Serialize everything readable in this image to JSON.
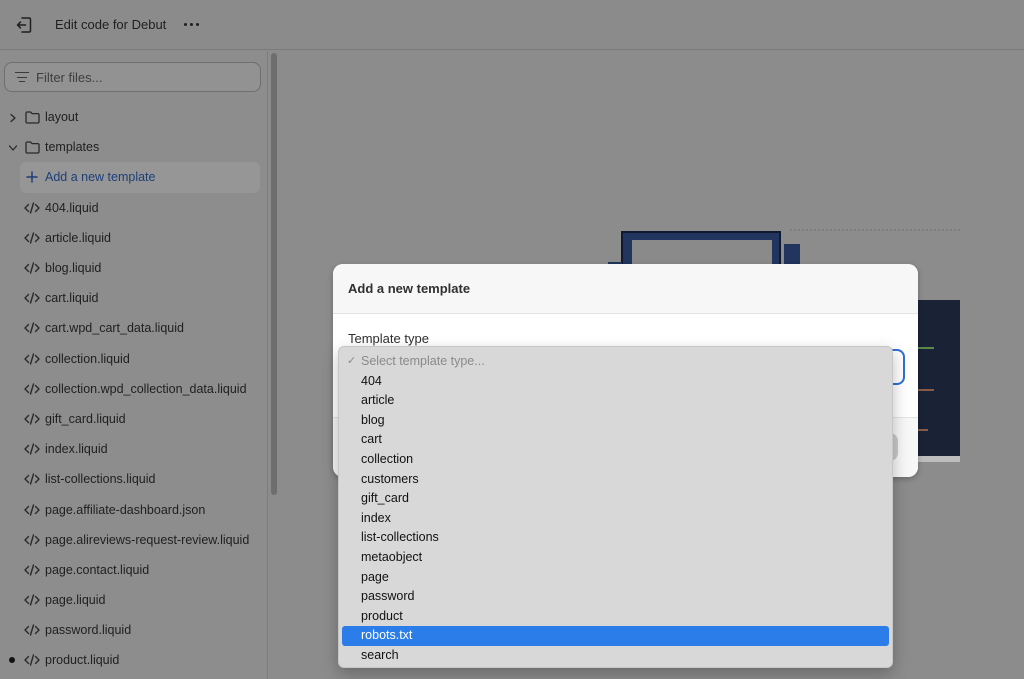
{
  "header": {
    "title": "Edit code for Debut",
    "exit_icon": "exit-icon",
    "more_icon": "more-horizontal-icon"
  },
  "sidebar": {
    "filter_placeholder": "Filter files...",
    "items": [
      {
        "label": "layout",
        "kind": "folder",
        "expanded": false
      },
      {
        "label": "templates",
        "kind": "folder",
        "expanded": true
      },
      {
        "label": "Add a new template",
        "kind": "add"
      },
      {
        "label": "404.liquid",
        "kind": "file"
      },
      {
        "label": "article.liquid",
        "kind": "file"
      },
      {
        "label": "blog.liquid",
        "kind": "file"
      },
      {
        "label": "cart.liquid",
        "kind": "file"
      },
      {
        "label": "cart.wpd_cart_data.liquid",
        "kind": "file"
      },
      {
        "label": "collection.liquid",
        "kind": "file"
      },
      {
        "label": "collection.wpd_collection_data.liquid",
        "kind": "file"
      },
      {
        "label": "gift_card.liquid",
        "kind": "file"
      },
      {
        "label": "index.liquid",
        "kind": "file"
      },
      {
        "label": "list-collections.liquid",
        "kind": "file"
      },
      {
        "label": "page.affiliate-dashboard.json",
        "kind": "file"
      },
      {
        "label": "page.alireviews-request-review.liquid",
        "kind": "file"
      },
      {
        "label": "page.contact.liquid",
        "kind": "file"
      },
      {
        "label": "page.liquid",
        "kind": "file"
      },
      {
        "label": "password.liquid",
        "kind": "file"
      },
      {
        "label": "product.liquid",
        "kind": "file",
        "modified": true
      }
    ]
  },
  "modal": {
    "title": "Add a new template",
    "field_label": "Template type"
  },
  "dropdown": {
    "placeholder": "Select template type...",
    "selected": "robots.txt",
    "options": [
      "404",
      "article",
      "blog",
      "cart",
      "collection",
      "customers",
      "gift_card",
      "index",
      "list-collections",
      "metaobject",
      "page",
      "password",
      "product",
      "robots.txt",
      "search"
    ]
  },
  "colors": {
    "accent": "#2b7de9",
    "link": "#1d3f78",
    "overlay": "#8c8c8c"
  }
}
